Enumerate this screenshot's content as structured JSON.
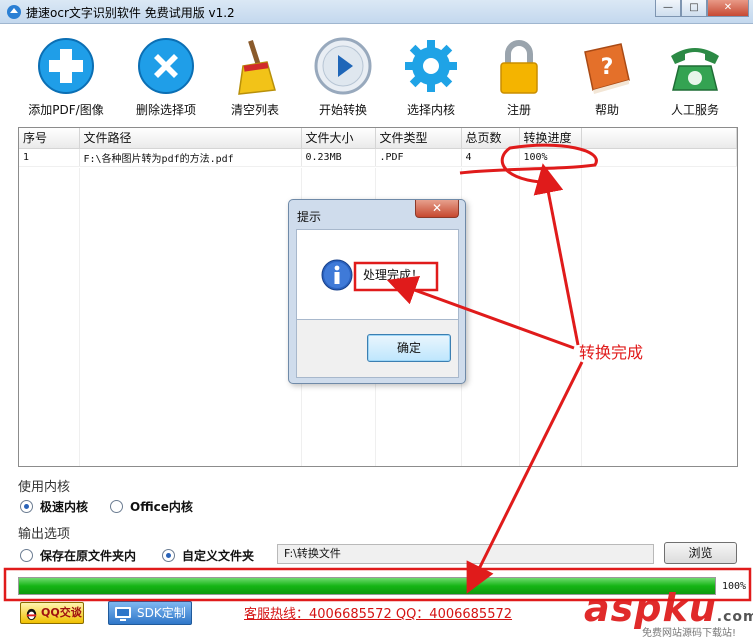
{
  "window": {
    "title": "捷速ocr文字识别软件 免费试用版 v1.2",
    "min_glyph": "—",
    "max_glyph": "□",
    "close_glyph": "✕"
  },
  "toolbar": {
    "items": [
      {
        "label": "添加PDF/图像",
        "icon": "add-icon"
      },
      {
        "label": "删除选择项",
        "icon": "delete-icon"
      },
      {
        "label": "清空列表",
        "icon": "broom-icon"
      },
      {
        "label": "开始转换",
        "icon": "play-icon"
      },
      {
        "label": "选择内核",
        "icon": "gear-icon"
      },
      {
        "label": "注册",
        "icon": "lock-icon"
      },
      {
        "label": "帮助",
        "icon": "help-book-icon"
      },
      {
        "label": "人工服务",
        "icon": "phone-icon"
      }
    ]
  },
  "table": {
    "columns": [
      "序号",
      "文件路径",
      "文件大小",
      "文件类型",
      "总页数",
      "转换进度"
    ],
    "rows": [
      [
        "1",
        "F:\\各种图片转为pdf的方法.pdf",
        "0.23MB",
        ".PDF",
        "4",
        "100%"
      ]
    ]
  },
  "dialog": {
    "title": "提示",
    "close_glyph": "✕",
    "message": "处理完成！",
    "ok_label": "确定"
  },
  "engine": {
    "section_label": "使用内核",
    "options": [
      {
        "label": "极速内核",
        "selected": true
      },
      {
        "label": "Office内核",
        "selected": false
      }
    ]
  },
  "output": {
    "section_label": "输出选项",
    "options": [
      {
        "label": "保存在原文件夹内",
        "selected": false
      },
      {
        "label": "自定义文件夹",
        "selected": true
      }
    ],
    "path_value": "F:\\转换文件",
    "browse_label": "浏览"
  },
  "progress": {
    "value": 1.0,
    "label": "100%"
  },
  "footer": {
    "qq_label": "QQ交谈",
    "sdk_label": "SDK定制",
    "hotline": "客服热线：4006685572 QQ：4006685572"
  },
  "annotation": {
    "text": "转换完成",
    "color": "#e01b1b"
  },
  "watermark": {
    "logo": "aspku",
    "logo_com": ".com",
    "sub": "免费网站源码下载站!"
  }
}
